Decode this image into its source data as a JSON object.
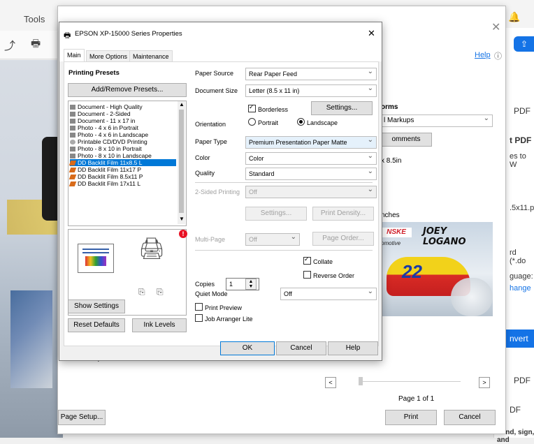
{
  "app": {
    "menu_tools": "Tools",
    "right_items": [
      "PDF",
      "t PDF",
      "es to W",
      ".5x11.p",
      "rd (*.do",
      "guage:",
      "hange",
      "nvert",
      "PDF",
      "DF",
      "Send, sign, and"
    ]
  },
  "print_panel": {
    "help_link": "Help",
    "forms_label": "orms",
    "forms_select": "l Markups",
    "comments_button": "omments",
    "size_text": "x 8.5in",
    "units_text": "nches",
    "preview_brand": "NSKE",
    "preview_name": "JOEY LOGANO",
    "preview_sub": "omotive",
    "preview_number": "22",
    "orientation_label": "Landscape",
    "prev_button": "<",
    "next_button": ">",
    "page_info": "Page 1 of 1",
    "page_setup_button": "Page Setup...",
    "print_button": "Print",
    "cancel_button": "Cancel"
  },
  "dialog": {
    "title": "EPSON XP-15000 Series Properties",
    "tabs": [
      "Main",
      "More Options",
      "Maintenance"
    ],
    "printing_presets_heading": "Printing Presets",
    "add_remove_button": "Add/Remove Presets...",
    "presets": [
      "Document - High Quality",
      "Document - 2-Sided",
      "Document - 11 x 17 in",
      "Photo - 4 x 6 in Portrait",
      "Photo - 4 x 6 in Landscape",
      "Printable CD/DVD Printing",
      "Photo - 8 x 10 in Portrait",
      "Photo - 8 x 10 in Landscape",
      "DD Backlit Film 11x8.5 L",
      "DD Backlit Film 11x17 P",
      "DD Backlit Film 8.5x11 P",
      "DD Backlit Film 17x11 L"
    ],
    "selected_preset_index": 8,
    "show_settings_button": "Show Settings",
    "reset_defaults_button": "Reset Defaults",
    "ink_levels_button": "Ink Levels",
    "paper_source_label": "Paper Source",
    "paper_source_value": "Rear Paper Feed",
    "document_size_label": "Document Size",
    "document_size_value": "Letter (8.5 x 11 in)",
    "borderless_label": "Borderless",
    "settings_button": "Settings...",
    "orientation_label": "Orientation",
    "portrait_label": "Portrait",
    "landscape_label": "Landscape",
    "paper_type_label": "Paper Type",
    "paper_type_value": "Premium Presentation Paper Matte",
    "color_label": "Color",
    "color_value": "Color",
    "quality_label": "Quality",
    "quality_value": "Standard",
    "two_sided_label": "2-Sided Printing",
    "two_sided_value": "Off",
    "settings2_button": "Settings...",
    "print_density_button": "Print Density...",
    "multipage_label": "Multi-Page",
    "multipage_value": "Off",
    "page_order_button": "Page Order...",
    "copies_label": "Copies",
    "copies_value": "1",
    "collate_label": "Collate",
    "reverse_order_label": "Reverse Order",
    "quiet_mode_label": "Quiet Mode",
    "quiet_mode_value": "Off",
    "print_preview_label": "Print Preview",
    "job_arranger_label": "Job Arranger Lite",
    "ok_button": "OK",
    "cancel_button": "Cancel",
    "help_button": "Help"
  },
  "colors": {
    "accent": "#0078d7",
    "adobe_blue": "#1473e6",
    "warning": "#e81123"
  }
}
